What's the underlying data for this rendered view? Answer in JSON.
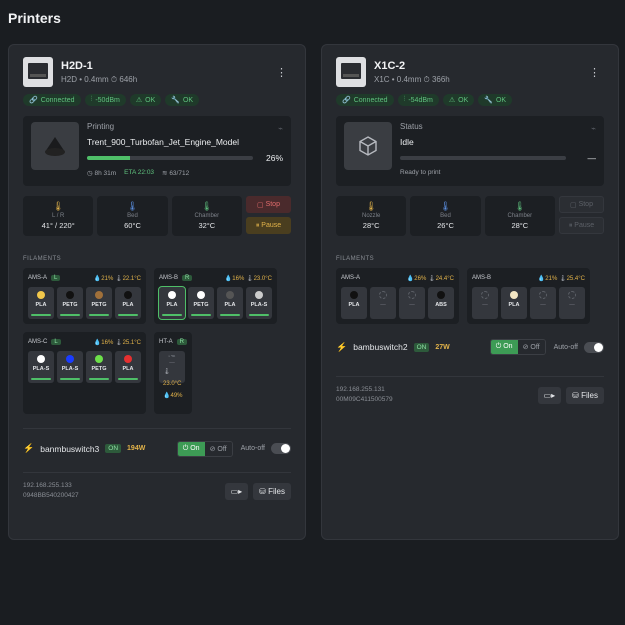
{
  "page": {
    "title": "Printers"
  },
  "printers": [
    {
      "name": "H2D-1",
      "sub": "H2D • 0.4mm ⏱ 646h",
      "badges": [
        "Connected",
        "-50dBm",
        "OK",
        "OK"
      ],
      "status_label": "Printing",
      "job": "Trent_900_Turbofan_Jet_Engine_Model",
      "progress_pct": 26,
      "progress_text": "26%",
      "time_left": "8h 31m",
      "eta": "ETA 22:03",
      "layers": "63/712",
      "temps": [
        {
          "label": "L / R",
          "value": "41° / 220°",
          "icon": "nozzle-icon",
          "color": "#e2b34a"
        },
        {
          "label": "Bed",
          "value": "60°C",
          "icon": "bed-icon",
          "color": "#5b8fe0"
        },
        {
          "label": "Chamber",
          "value": "32°C",
          "icon": "chamber-icon",
          "color": "#5fc27e"
        }
      ],
      "stop": "Stop",
      "pause": "Pause",
      "filaments_label": "FILAMENTS",
      "ams": [
        {
          "name": "AMS-A",
          "tag": "L",
          "humidity": "21%",
          "temp": "22.1°C",
          "slots": [
            {
              "name": "PLA",
              "color": "#f2c84b"
            },
            {
              "name": "PETG",
              "color": "#111111"
            },
            {
              "name": "PETG",
              "color": "#a0703a"
            },
            {
              "name": "PLA",
              "color": "#111111"
            }
          ]
        },
        {
          "name": "AMS-B",
          "tag": "R",
          "humidity": "16%",
          "temp": "23.0°C",
          "slots": [
            {
              "name": "PLA",
              "color": "#ffffff"
            },
            {
              "name": "PETG",
              "color": "#ffffff"
            },
            {
              "name": "PLA",
              "color": "#555555"
            },
            {
              "name": "PLA-S",
              "color": "#cccccc"
            }
          ]
        },
        {
          "name": "AMS-C",
          "tag": "L",
          "humidity": "16%",
          "temp": "25.1°C",
          "slots": [
            {
              "name": "PLA-S",
              "color": "#ffffff"
            },
            {
              "name": "PLA-S",
              "color": "#1a3cff"
            },
            {
              "name": "PETG",
              "color": "#6de04a"
            },
            {
              "name": "PLA",
              "color": "#e63030"
            }
          ]
        },
        {
          "name": "HT-A",
          "tag": "R",
          "humidity": "49%",
          "temp": "23.0°C",
          "slots": [
            {
              "name": "—",
              "color": ""
            }
          ]
        }
      ],
      "switch_name": "banmbuswitch3",
      "switch_state": "ON",
      "watts": "194W",
      "on_label": "On",
      "off_label": "Off",
      "auto_off": "Auto-off",
      "ip": "192.168.255.133",
      "serial": "0948BB540200427",
      "files": "Files"
    },
    {
      "name": "X1C-2",
      "sub": "X1C • 0.4mm ⏱ 366h",
      "badges": [
        "Connected",
        "-54dBm",
        "OK",
        "OK"
      ],
      "status_label": "Status",
      "job": "Idle",
      "progress_pct": 0,
      "progress_text": "—",
      "status_msg": "Ready to print",
      "temps": [
        {
          "label": "Nozzle",
          "value": "28°C",
          "icon": "nozzle-icon",
          "color": "#e2b34a"
        },
        {
          "label": "Bed",
          "value": "26°C",
          "icon": "bed-icon",
          "color": "#5b8fe0"
        },
        {
          "label": "Chamber",
          "value": "28°C",
          "icon": "chamber-icon",
          "color": "#5fc27e"
        }
      ],
      "stop": "Stop",
      "pause": "Pause",
      "filaments_label": "FILAMENTS",
      "ams": [
        {
          "name": "AMS-A",
          "humidity": "26%",
          "temp": "24.4°C",
          "slots": [
            {
              "name": "PLA",
              "color": "#111111"
            },
            {
              "name": "—",
              "color": ""
            },
            {
              "name": "—",
              "color": ""
            },
            {
              "name": "ABS",
              "color": "#111111"
            }
          ]
        },
        {
          "name": "AMS-B",
          "humidity": "21%",
          "temp": "25.4°C",
          "slots": [
            {
              "name": "—",
              "color": ""
            },
            {
              "name": "PLA",
              "color": "#f3e6c4"
            },
            {
              "name": "—",
              "color": ""
            },
            {
              "name": "—",
              "color": ""
            }
          ]
        }
      ],
      "switch_name": "bambuswitch2",
      "switch_state": "ON",
      "watts": "27W",
      "on_label": "On",
      "off_label": "Off",
      "auto_off": "Auto-off",
      "ip": "192.168.255.131",
      "serial": "00M09C411500579",
      "files": "Files"
    }
  ]
}
